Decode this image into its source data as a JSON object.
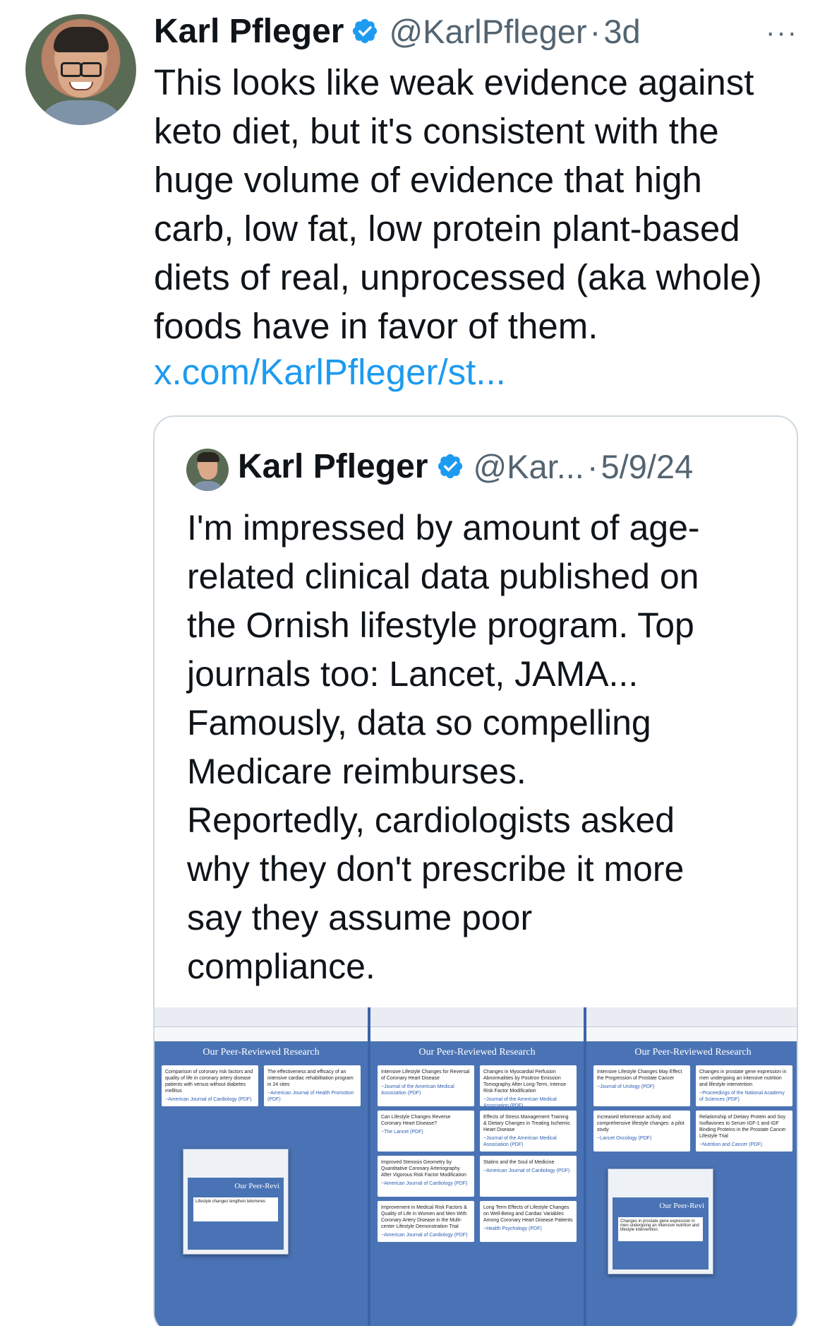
{
  "tweet": {
    "author_name": "Karl Pfleger",
    "handle": "@KarlPfleger",
    "separator": "·",
    "time": "3d",
    "more_label": "···",
    "text_lines": [
      "This looks like weak evidence against",
      "keto diet, but it's consistent with the",
      "huge volume of evidence that high",
      "carb, low fat, low protein plant-based",
      "diets of real, unprocessed (aka whole)",
      "foods have in favor of them."
    ],
    "link": "x.com/KarlPfleger/st..."
  },
  "quoted": {
    "author_name": "Karl Pfleger",
    "handle": "@Kar...",
    "separator": "·",
    "time": "5/9/24",
    "text_lines": [
      "I'm impressed by amount of age-",
      "related clinical data published on",
      "the Ornish lifestyle program. Top",
      "journals too: Lancet, JAMA...",
      "Famously, data so compelling",
      "Medicare reimburses.",
      "Reportedly, cardiologists asked",
      "why they don't prescribe it more",
      "say they assume poor",
      "compliance."
    ],
    "media": [
      {
        "title": "Our Peer-Reviewed Research",
        "cards": [
          {
            "text": "Comparison of coronary risk factors and quality of life in coronary artery disease patients with versus without diabetes mellitus",
            "cite": "~American Journal of Cardiology (PDF)"
          },
          {
            "text": "The effectiveness and efficacy of an intensive cardiac rehabilitation program in 24 sites",
            "cite": "~American Journal of Health Promotion (PDF)"
          }
        ],
        "inset_title": "Our Peer-Revi",
        "inset_card": "Lifestyle changes lengthen telomeres"
      },
      {
        "title": "Our Peer-Reviewed Research",
        "cards": [
          {
            "text": "Intensive Lifestyle Changes for Reversal of Coronary Heart Disease",
            "cite": "~Journal of the American Medical Association (PDF)"
          },
          {
            "text": "Changes in Myocardial Perfusion Abnormalities by Positron Emission Tomography After Long-Term, Intense Risk Factor Modification",
            "cite": "~Journal of the American Medical Association (PDF)"
          },
          {
            "text": "Can Lifestyle Changes Reverse Coronary Heart Disease?",
            "cite": "~The Lancet (PDF)"
          },
          {
            "text": "Effects of Stress Management Training & Dietary Changes in Treating Ischemic Heart Disease",
            "cite": "~Journal of the American Medical Association (PDF)"
          },
          {
            "text": "Improved Stenosis Geometry by Quantitative Coronary Arteriography After Vigorous Risk Factor Modification",
            "cite": "~American Journal of Cardiology (PDF)"
          },
          {
            "text": "Statins and the Soul of Medicine",
            "cite": "~American Journal of Cardiology (PDF)"
          },
          {
            "text": "Improvement in Medical Risk Factors & Quality of Life in Women and Men With Coronary Artery Disease in the Multi-center Lifestyle Demonstration Trial",
            "cite": "~American Journal of Cardiology (PDF)"
          },
          {
            "text": "Long Term Effects of Lifestyle Changes on Well-Being and Cardiac Variables Among Coronary Heart Disease Patients",
            "cite": "~Health Psychology (PDF)"
          }
        ]
      },
      {
        "title": "Our Peer-Reviewed Research",
        "cards": [
          {
            "text": "Intensive Lifestyle Changes May Effect the Progression of Prostate Cancer",
            "cite": "~Journal of Urology (PDF)"
          },
          {
            "text": "Changes in prostate gene expression in men undergoing an intensive nutrition and lifestyle intervention",
            "cite": "~Proceedings of the National Academy of Sciences (PDF)"
          },
          {
            "text": "Increased telomerase activity and comprehensive lifestyle changes: a pilot study",
            "cite": "~Lancet Oncology (PDF)"
          },
          {
            "text": "Relationship of Dietary Protein and Soy Isoflavones to Serum IGF-1 and IGF Binding Proteins in the Prostate Cancer Lifestyle Trial",
            "cite": "~Nutrition and Cancer (PDF)"
          }
        ],
        "inset_title": "Our Peer-Revi",
        "inset_card": "Changes in prostate gene expression in men undergoing an intensive nutrition and lifestyle intervention."
      }
    ]
  },
  "colors": {
    "link": "#1d9bf0",
    "verified": "#1d9bf0",
    "secondary_text": "#536471",
    "media_bg": "#4a73b5"
  },
  "icons": {
    "verified": "verified-badge-icon",
    "more": "more-horizontal-icon"
  }
}
